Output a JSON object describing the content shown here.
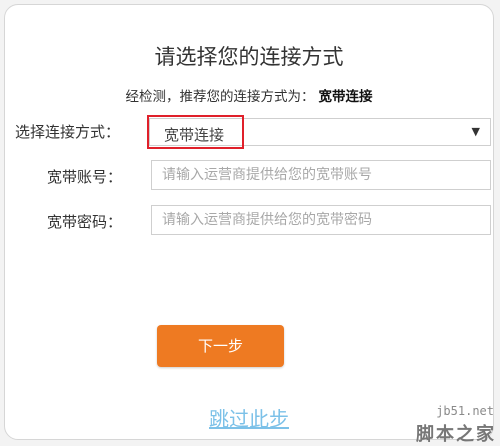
{
  "dialog": {
    "title": "请选择您的连接方式",
    "subtitle_prefix": "经检测，推荐您的连接方式为：",
    "recommended": "宽带连接"
  },
  "connection": {
    "label": "选择连接方式：",
    "selected": "宽带连接",
    "arrow": "▼"
  },
  "account": {
    "label": "宽带账号：",
    "placeholder": "请输入运营商提供给您的宽带账号"
  },
  "password": {
    "label": "宽带密码：",
    "placeholder": "请输入运营商提供给您的宽带密码"
  },
  "next_button": "下一步",
  "skip_link": "跳过此步",
  "watermark": {
    "site": "jb51.net",
    "text": "脚本之家"
  },
  "colors": {
    "accent": "#ee7a22",
    "link": "#7cc1e8",
    "highlight": "#e0202a"
  }
}
